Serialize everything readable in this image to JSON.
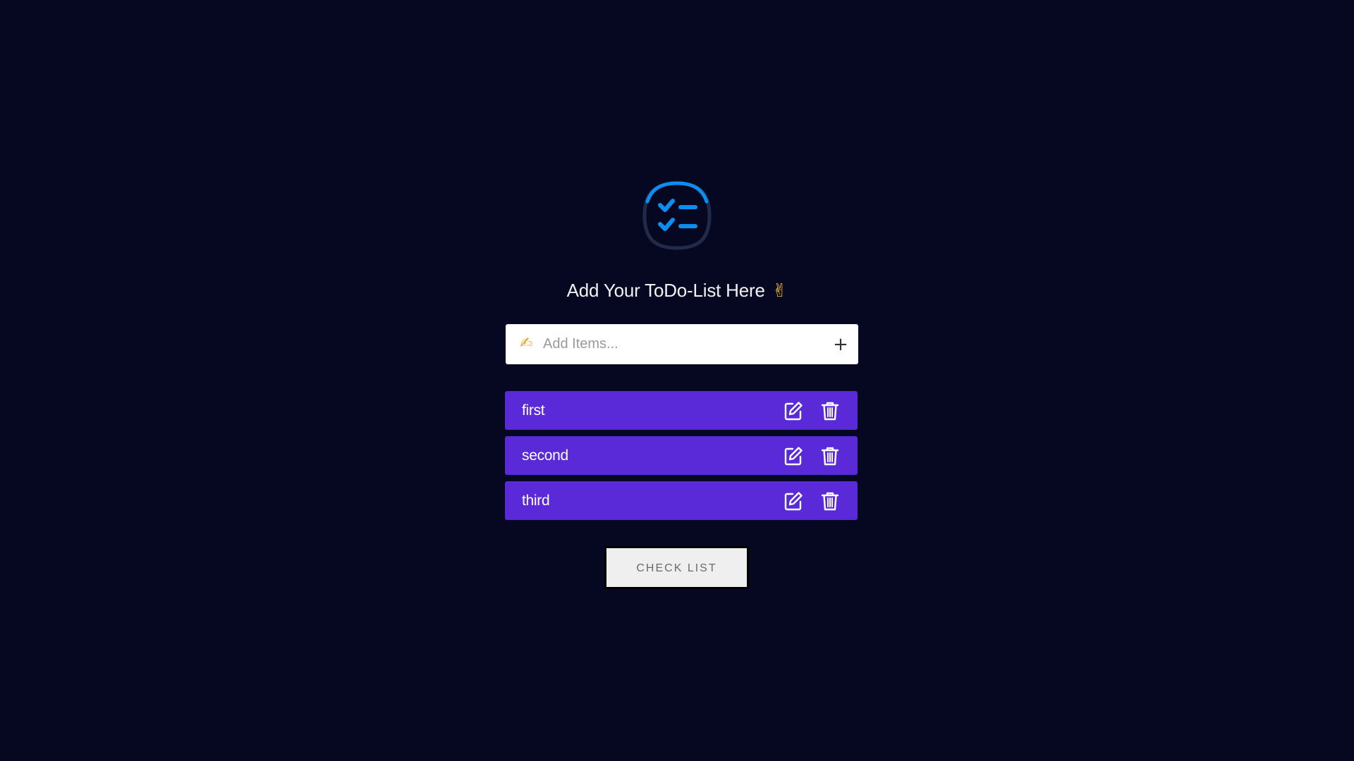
{
  "logo": {
    "icon": "checklist-icon",
    "colors": {
      "ring": "#222a4a",
      "accent": "#0c8ef0"
    }
  },
  "heading": {
    "text": "Add Your ToDo-List Here",
    "emoji": "✌"
  },
  "add_item": {
    "icon": "writing-hand-icon",
    "icon_glyph": "✍",
    "placeholder": "Add Items...",
    "value": "",
    "add_button_icon": "plus-icon",
    "add_button_glyph": "+"
  },
  "items": [
    {
      "label": "first",
      "edit_icon": "edit-icon",
      "delete_icon": "trash-icon"
    },
    {
      "label": "second",
      "edit_icon": "edit-icon",
      "delete_icon": "trash-icon"
    },
    {
      "label": "third",
      "edit_icon": "edit-icon",
      "delete_icon": "trash-icon"
    }
  ],
  "check_button": {
    "label": "CHECK LIST"
  },
  "colors": {
    "background": "#060822",
    "item_background": "#5a2ad8",
    "input_background": "#ffffff",
    "button_background": "#efefef",
    "button_border": "#000000"
  }
}
